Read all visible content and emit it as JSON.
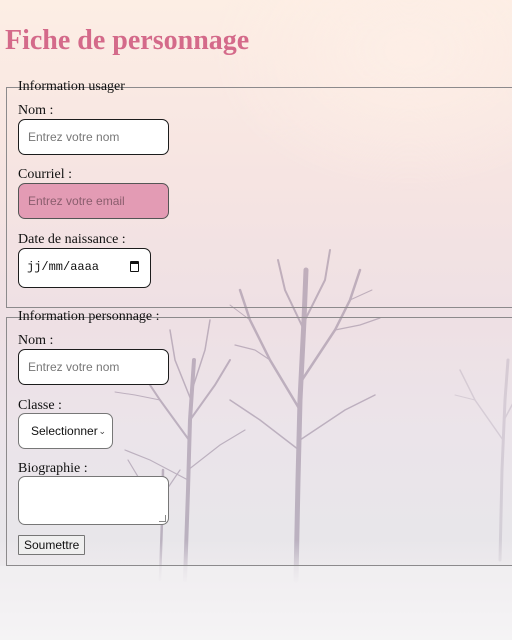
{
  "page": {
    "title": "Fiche de personnage"
  },
  "user_info": {
    "legend": "Information usager",
    "name_label": "Nom :",
    "name_placeholder": "Entrez votre nom",
    "email_label": "Courriel :",
    "email_placeholder": "Entrez votre email",
    "birthdate_label": "Date de naissance :",
    "birthdate_placeholder": "jj/mm/aaaa"
  },
  "character_info": {
    "legend": "Information personnage :",
    "name_label": "Nom :",
    "name_placeholder": "Entrez votre nom",
    "class_label": "Classe :",
    "class_selected": "Selectionner",
    "bio_label": "Biographie :",
    "bio_value": "",
    "submit_label": "Soumettre"
  },
  "colors": {
    "title": "#d46a8a",
    "email_field_bg": "#e39bb4"
  },
  "icons": {
    "calendar": "calendar-icon",
    "dropdown": "chevron-down-icon",
    "resize": "resize-grip-icon"
  }
}
